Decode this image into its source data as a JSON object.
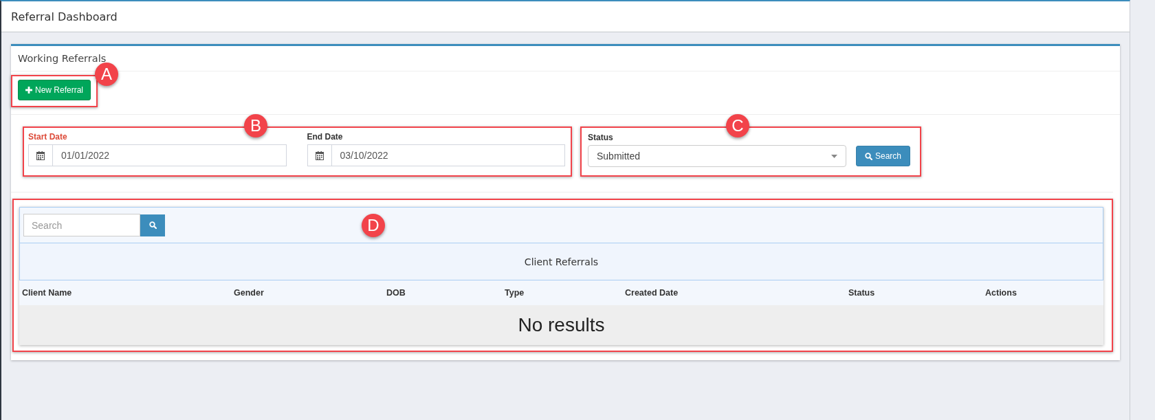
{
  "header": {
    "title": "Referral Dashboard"
  },
  "panel": {
    "title": "Working Referrals",
    "new_button": {
      "label": "New Referral",
      "callout": "A"
    },
    "dates": {
      "callout": "B",
      "fields": [
        {
          "label": "Start Date",
          "value": "01/01/2022",
          "invalid": true
        },
        {
          "label": "End Date",
          "value": "03/10/2022",
          "invalid": false
        }
      ]
    },
    "status_filter": {
      "callout": "C",
      "label": "Status",
      "value": "Submitted",
      "search_button": "Search"
    },
    "table": {
      "callout": "D",
      "search": {
        "placeholder": "Search"
      },
      "caption": "Client Referrals",
      "columns": [
        "Client Name",
        "Gender",
        "DOB",
        "Type",
        "Created Date",
        "Status",
        "Actions"
      ],
      "empty_message": "No results"
    }
  }
}
